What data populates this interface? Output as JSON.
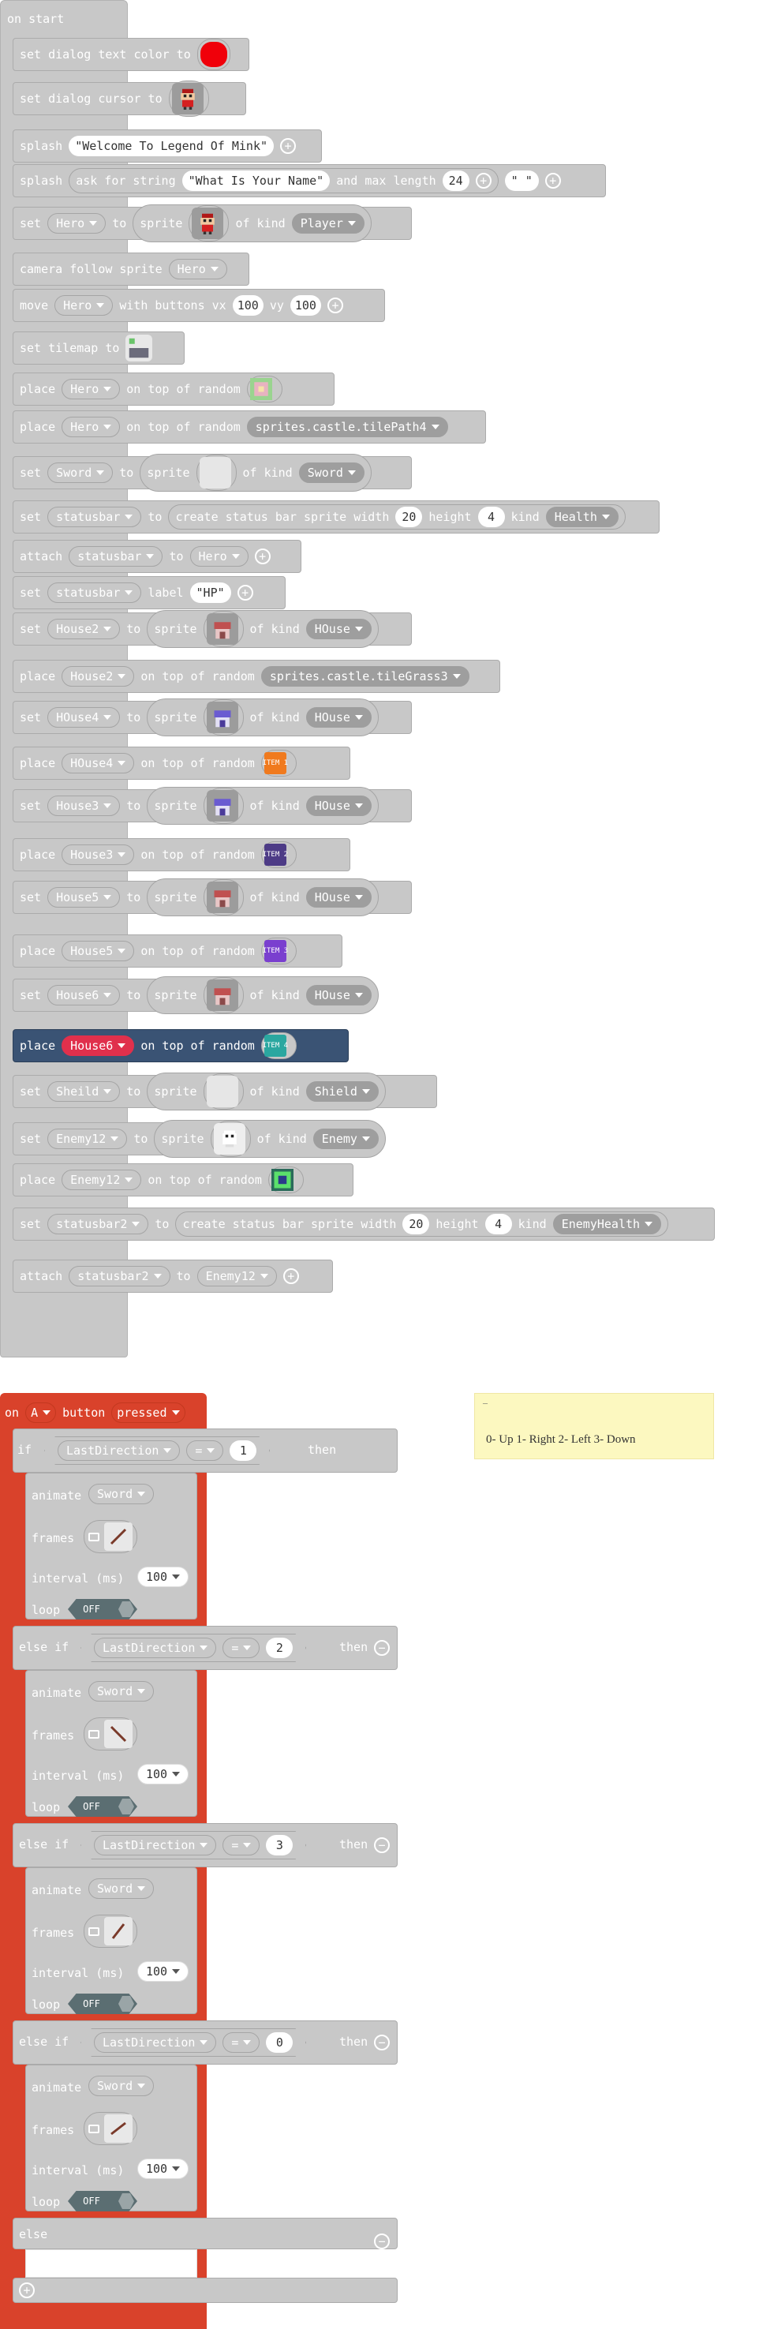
{
  "on_start": {
    "label": "on start",
    "rows": [
      {
        "kind": "color",
        "w": [
          "set dialog text color to"
        ],
        "color": "#f0000a"
      },
      {
        "kind": "cursor",
        "w": [
          "set dialog cursor to"
        ]
      },
      {
        "kind": "splash1",
        "w": [
          "splash"
        ],
        "str": "\"Welcome To Legend Of Mink\""
      },
      {
        "kind": "splash2",
        "w": [
          "splash",
          "ask for string",
          "and max length"
        ],
        "str": "\"What Is Your Name\"",
        "num": "24",
        "str2": "\" \""
      },
      {
        "kind": "setsprite",
        "w": [
          "set",
          "to",
          "sprite",
          "of kind"
        ],
        "var": "Hero",
        "kindv": "Player",
        "img": "hero"
      },
      {
        "kind": "simple",
        "w": [
          "camera follow sprite"
        ],
        "var": "Hero"
      },
      {
        "kind": "move",
        "w": [
          "move",
          "with buttons vx",
          "vy"
        ],
        "var": "Hero",
        "vx": "100",
        "vy": "100"
      },
      {
        "kind": "tilemap",
        "w": [
          "set tilemap to"
        ]
      },
      {
        "kind": "placeimg",
        "w": [
          "place",
          "on top of random"
        ],
        "var": "Hero",
        "img": "tile-green"
      },
      {
        "kind": "placedd",
        "w": [
          "place",
          "on top of random"
        ],
        "var": "Hero",
        "dd": "sprites.castle.tilePath4"
      },
      {
        "kind": "setsprite",
        "w": [
          "set",
          "to",
          "sprite",
          "of kind"
        ],
        "var": "Sword",
        "kindv": "Sword",
        "img": "blank"
      },
      {
        "kind": "status",
        "w": [
          "set",
          "to",
          "create status bar sprite width",
          "height",
          "kind"
        ],
        "var": "statusbar",
        "width": "20",
        "height": "4",
        "kindv": "Health"
      },
      {
        "kind": "attach",
        "w": [
          "attach",
          "to"
        ],
        "var": "statusbar",
        "var2": "Hero"
      },
      {
        "kind": "label",
        "w": [
          "set",
          "label"
        ],
        "var": "statusbar",
        "str": "\"HP\""
      },
      {
        "kind": "setsprite",
        "w": [
          "set",
          "to",
          "sprite",
          "of kind"
        ],
        "var": "House2",
        "kindv": "HOuse",
        "img": "house-red"
      },
      {
        "kind": "placedd",
        "w": [
          "place",
          "on top of random"
        ],
        "var": "House2",
        "dd": "sprites.castle.tileGrass3"
      },
      {
        "kind": "setsprite",
        "w": [
          "set",
          "to",
          "sprite",
          "of kind"
        ],
        "var": "HOuse4",
        "kindv": "HOuse",
        "img": "house-blue"
      },
      {
        "kind": "placeimg",
        "w": [
          "place",
          "on top of random"
        ],
        "var": "HOuse4",
        "img": "item1"
      },
      {
        "kind": "setsprite",
        "w": [
          "set",
          "to",
          "sprite",
          "of kind"
        ],
        "var": "House3",
        "kindv": "HOuse",
        "img": "house-blue"
      },
      {
        "kind": "placeimg",
        "w": [
          "place",
          "on top of random"
        ],
        "var": "House3",
        "img": "item2"
      },
      {
        "kind": "setsprite",
        "w": [
          "set",
          "to",
          "sprite",
          "of kind"
        ],
        "var": "House5",
        "kindv": "HOuse",
        "img": "house-red"
      },
      {
        "kind": "placeimg",
        "w": [
          "place",
          "on top of random"
        ],
        "var": "House5",
        "img": "item3"
      },
      {
        "kind": "setsprite",
        "w": [
          "set",
          "to",
          "sprite",
          "of kind"
        ],
        "var": "House6",
        "kindv": "HOuse",
        "img": "house-red"
      },
      {
        "kind": "placeimg_sel",
        "w": [
          "place",
          "on top of random"
        ],
        "var": "House6",
        "img": "item4"
      },
      {
        "kind": "setsprite",
        "w": [
          "set",
          "to",
          "sprite",
          "of kind"
        ],
        "var": "Sheild",
        "kindv": "Shield",
        "img": "blank"
      },
      {
        "kind": "setsprite",
        "w": [
          "set",
          "to",
          "sprite",
          "of kind"
        ],
        "var": "Enemy12",
        "kindv": "Enemy",
        "img": "ghost"
      },
      {
        "kind": "placeimg",
        "w": [
          "place",
          "on top of random"
        ],
        "var": "Enemy12",
        "img": "tile-green2"
      },
      {
        "kind": "status",
        "w": [
          "set",
          "to",
          "create status bar sprite width",
          "height",
          "kind"
        ],
        "var": "statusbar2",
        "width": "20",
        "height": "4",
        "kindv": "EnemyHealth"
      },
      {
        "kind": "attach",
        "w": [
          "attach",
          "to"
        ],
        "var": "statusbar2",
        "var2": "Enemy12"
      }
    ]
  },
  "items": {
    "item1": "ITEM 1",
    "item2": "ITEM 2",
    "item3": "ITEM 3",
    "item4": "ITEM 4"
  },
  "on_button": {
    "on": "on",
    "button": "A",
    "mid": "button",
    "event": "pressed",
    "if": "if",
    "else_if": "else if",
    "else": "else",
    "then": "then",
    "cond_var": "LastDirection",
    "op": "=",
    "branches": [
      {
        "value": "1",
        "animate": "animate",
        "sprite": "Sword",
        "frames": "frames",
        "interval": "interval (ms)",
        "ms": "100",
        "loop": "loop",
        "off": "OFF"
      },
      {
        "value": "2",
        "animate": "animate",
        "sprite": "Sword",
        "frames": "frames",
        "interval": "interval (ms)",
        "ms": "100",
        "loop": "loop",
        "off": "OFF"
      },
      {
        "value": "3",
        "animate": "animate",
        "sprite": "Sword",
        "frames": "frames",
        "interval": "interval (ms)",
        "ms": "100",
        "loop": "loop",
        "off": "OFF"
      },
      {
        "value": "0",
        "animate": "animate",
        "sprite": "Sword",
        "frames": "frames",
        "interval": "interval (ms)",
        "ms": "100",
        "loop": "loop",
        "off": "OFF"
      }
    ]
  },
  "comment": {
    "dash": "–",
    "text": "0- Up 1- Right 2- Left 3- Down"
  },
  "colors": {
    "block_gray": "#c8c8c8",
    "event_red": "#d9422b",
    "selected_blue": "#3a5374",
    "selected_red": "#e0304c",
    "comment_yellow": "#fcf8c0"
  }
}
